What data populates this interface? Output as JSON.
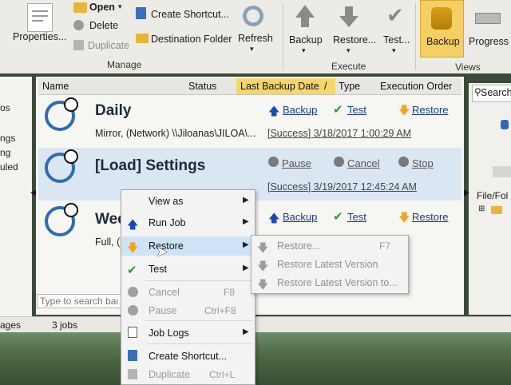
{
  "ribbon": {
    "properties_label": "Properties...",
    "open_label": "Open",
    "delete_label": "Delete",
    "duplicate_label": "Duplicate",
    "create_shortcut_label": "Create Shortcut...",
    "destination_folder_label": "Destination Folder",
    "refresh_label": "Refresh",
    "manage_group": "Manage",
    "backup_label": "Backup",
    "restore_label": "Restore...",
    "test_label": "Test...",
    "execute_group": "Execute",
    "backup_view_label": "Backup",
    "progress_view_label": "Progress",
    "views_group": "Views"
  },
  "left_pane": {
    "items": [
      "os",
      "ngs",
      "ng",
      "uled"
    ]
  },
  "columns": [
    "Name",
    "Status",
    "Last Backup Date",
    "Type",
    "Execution Order"
  ],
  "jobs": [
    {
      "title": "Daily",
      "description": "Mirror, (Network) \\\\Jiloanas\\JILOA\\...",
      "status": "[Success] 3/18/2017 1:00:29 AM",
      "actions": [
        "Backup",
        "Test",
        "Restore"
      ]
    },
    {
      "title": "[Load] Settings",
      "description": "",
      "status": "[Success] 3/19/2017 12:45:24 AM",
      "actions": [
        "Pause",
        "Cancel",
        "Stop"
      ]
    },
    {
      "title": "Wee",
      "description": "Full, (",
      "status": "",
      "actions": [
        "Backup",
        "Test",
        "Restore"
      ]
    }
  ],
  "search": {
    "placeholder": "Type to search bac"
  },
  "status_bar": {
    "left": "ages",
    "jobs": "3 jobs"
  },
  "right_pane": {
    "search": "Search",
    "folder_header": "File/Fol"
  },
  "context_menu": {
    "items": [
      {
        "label": "View as",
        "shortcut": "",
        "submenu": true,
        "disabled": false
      },
      {
        "label": "Run Job",
        "shortcut": "",
        "submenu": true,
        "disabled": false
      },
      {
        "label": "Restore",
        "shortcut": "",
        "submenu": true,
        "disabled": false
      },
      {
        "label": "Test",
        "shortcut": "",
        "submenu": true,
        "disabled": false
      },
      {
        "label": "Cancel",
        "shortcut": "F8",
        "submenu": false,
        "disabled": true
      },
      {
        "label": "Pause",
        "shortcut": "Ctrl+F8",
        "submenu": false,
        "disabled": true
      },
      {
        "label": "Job Logs",
        "shortcut": "",
        "submenu": true,
        "disabled": false
      },
      {
        "label": "Create Shortcut...",
        "shortcut": "",
        "submenu": false,
        "disabled": false
      },
      {
        "label": "Duplicate",
        "shortcut": "Ctrl+L",
        "submenu": false,
        "disabled": true
      }
    ]
  },
  "restore_submenu": {
    "items": [
      {
        "label": "Restore...",
        "shortcut": "F7"
      },
      {
        "label": "Restore Latest Version",
        "shortcut": ""
      },
      {
        "label": "Restore Latest Version to...",
        "shortcut": ""
      }
    ]
  },
  "colors": {
    "accent_orange": "#f0a420",
    "link_blue": "#1b3b8c",
    "highlight": "#cfe3f7",
    "views_selected": "#f4cf63"
  }
}
